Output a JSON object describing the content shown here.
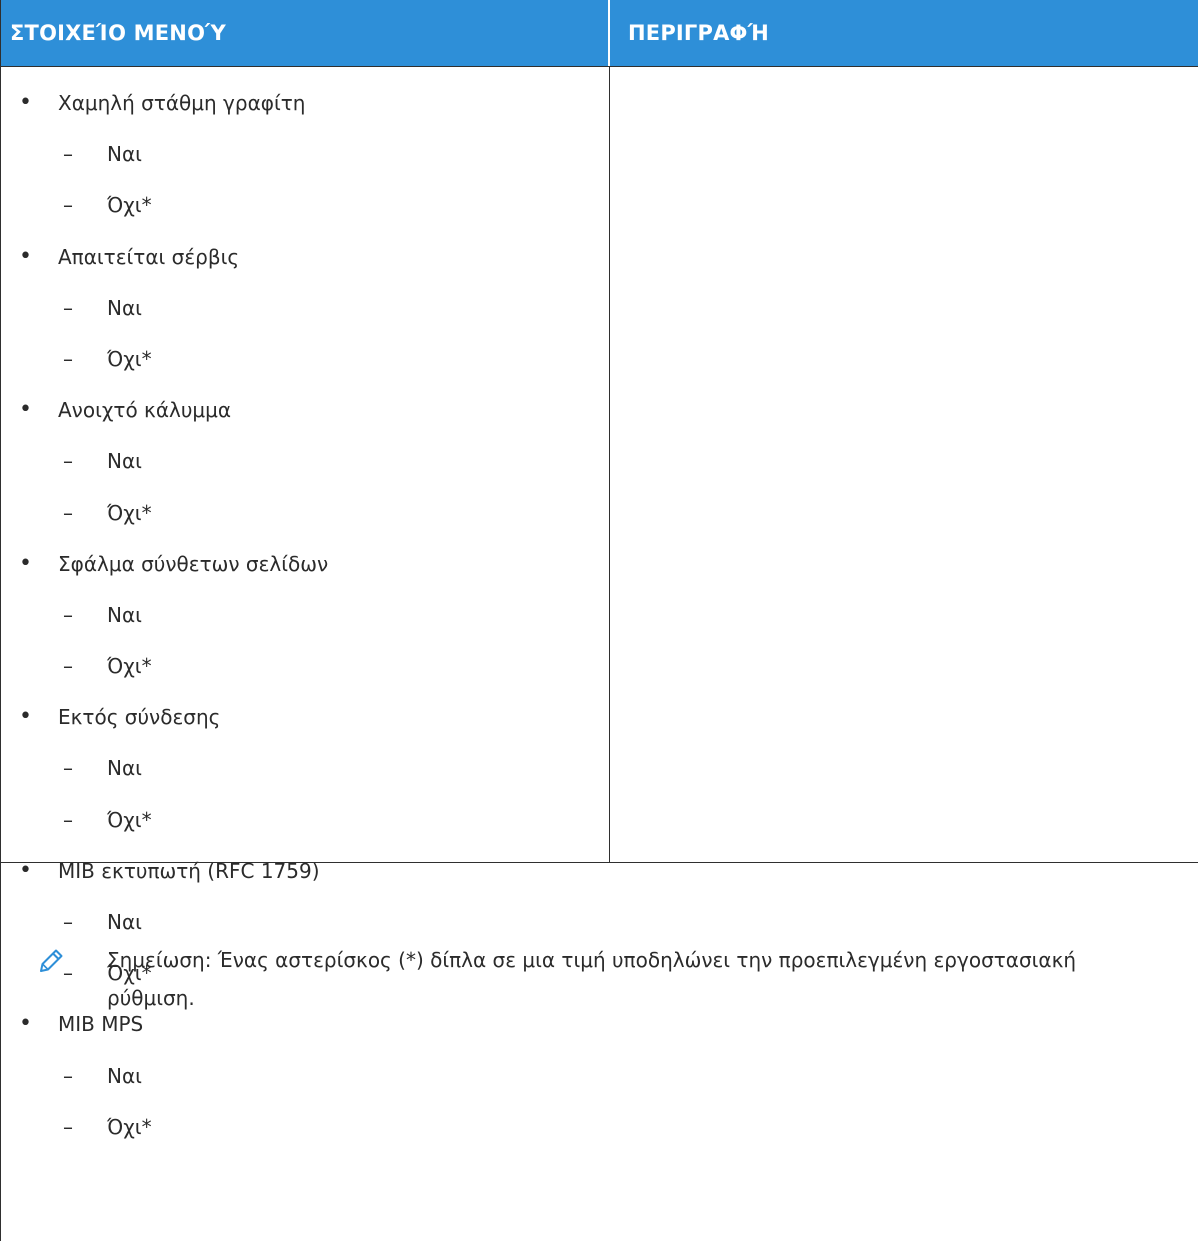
{
  "header": {
    "col1": "ΣΤΟΙΧΕΊΟ ΜΕΝΟΎ",
    "col2": "ΠΕΡΙΓΡΑΦΉ"
  },
  "items": [
    {
      "text": "Χαμηλή στάθμη γραφίτη",
      "level": 1
    },
    {
      "text": "Ναι",
      "level": 2
    },
    {
      "text": "Όχι*",
      "level": 2
    },
    {
      "text": "Απαιτείται σέρβις",
      "level": 1
    },
    {
      "text": "Ναι",
      "level": 2
    },
    {
      "text": "Όχι*",
      "level": 2
    },
    {
      "text": "Ανοιχτό κάλυμμα",
      "level": 1
    },
    {
      "text": "Ναι",
      "level": 2
    },
    {
      "text": "Όχι*",
      "level": 2
    },
    {
      "text": "Σφάλμα σύνθετων σελίδων",
      "level": 1
    },
    {
      "text": "Ναι",
      "level": 2
    },
    {
      "text": "Όχι*",
      "level": 2
    },
    {
      "text": "Εκτός σύνδεσης",
      "level": 1
    },
    {
      "text": "Ναι",
      "level": 2
    },
    {
      "text": "Όχι*",
      "level": 2
    },
    {
      "text": "MIB εκτυπωτή (RFC 1759)",
      "level": 1
    },
    {
      "text": "Ναι",
      "level": 2
    },
    {
      "text": "Όχι*",
      "level": 2
    },
    {
      "text": "MIB MPS",
      "level": 1
    },
    {
      "text": "Ναι",
      "level": 2
    },
    {
      "text": "Όχι*",
      "level": 2
    }
  ],
  "note": {
    "text": "Σημείωση: Ένας αστερίσκος (*) δίπλα σε μια τιμή υποδηλώνει την προεπιλεγμένη εργοστασιακή ρύθμιση.",
    "icon": "pencil-icon"
  },
  "colors": {
    "header_bg": "#2e8fd8",
    "header_text": "#ffffff",
    "border": "#2f2f2f",
    "note_icon": "#2e8fd8"
  }
}
